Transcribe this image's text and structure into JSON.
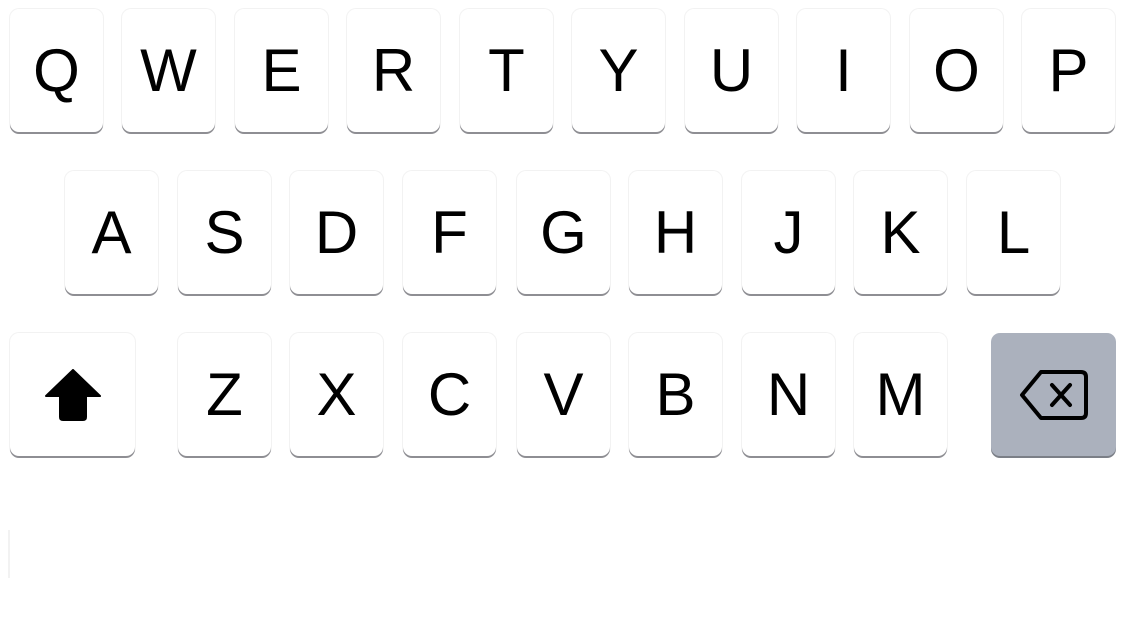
{
  "keyboard": {
    "row1": [
      "Q",
      "W",
      "E",
      "R",
      "T",
      "Y",
      "U",
      "I",
      "O",
      "P"
    ],
    "row2": [
      "A",
      "S",
      "D",
      "F",
      "G",
      "H",
      "J",
      "K",
      "L"
    ],
    "row3": [
      "Z",
      "X",
      "C",
      "V",
      "B",
      "N",
      "M"
    ],
    "shift_icon": "shift-arrow-icon",
    "delete_icon": "backspace-icon",
    "colors": {
      "key_bg": "#ffffff",
      "special_key_bg": "#abb1bd",
      "key_shadow": "#8e8e93",
      "text": "#000000"
    }
  }
}
